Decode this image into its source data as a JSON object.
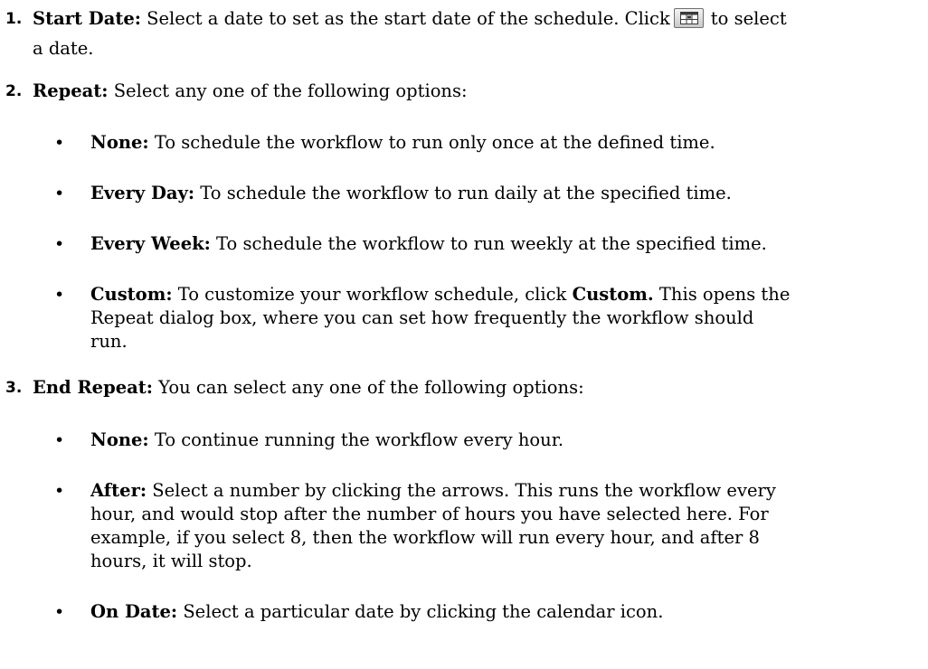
{
  "steps": [
    {
      "number": "1.",
      "label": "Start Date:",
      "text_before_icon": " Select a date to set as the start date of the schedule. Click",
      "icon": "calendar-icon",
      "text_after_icon": "to select",
      "text_line2": "a date."
    },
    {
      "number": "2.",
      "label": "Repeat:",
      "text": " Select any one of the following options:",
      "options": [
        {
          "label": "None:",
          "lines": [
            " To schedule the workflow to run only once at the defined time."
          ]
        },
        {
          "label": "Every Day:",
          "lines": [
            " To schedule the workflow to run daily at the specified time."
          ]
        },
        {
          "label": "Every Week:",
          "lines": [
            " To schedule the workflow to run weekly at the specified time."
          ]
        },
        {
          "label": "Custom:",
          "text_before_bold": " To customize your workflow schedule, click ",
          "bold": "Custom.",
          "text_after_bold": " This opens the",
          "lines": [
            "Repeat dialog box, where you can set how frequently the workflow should",
            "run."
          ]
        }
      ]
    },
    {
      "number": "3.",
      "label": "End Repeat:",
      "text": " You can select any one of the following options:",
      "options": [
        {
          "label": "None:",
          "lines": [
            " To continue running the workflow every hour."
          ]
        },
        {
          "label": "After:",
          "lines": [
            " Select a number by clicking the arrows. This runs the workflow every",
            "hour, and would stop after the number of hours you have selected here. For",
            "example, if you select 8, then the workflow will run every hour, and after 8",
            "hours, it will stop."
          ]
        },
        {
          "label": "On Date:",
          "lines": [
            " Select a particular date by clicking the calendar icon."
          ]
        }
      ]
    }
  ],
  "bullet_glyph": "•"
}
